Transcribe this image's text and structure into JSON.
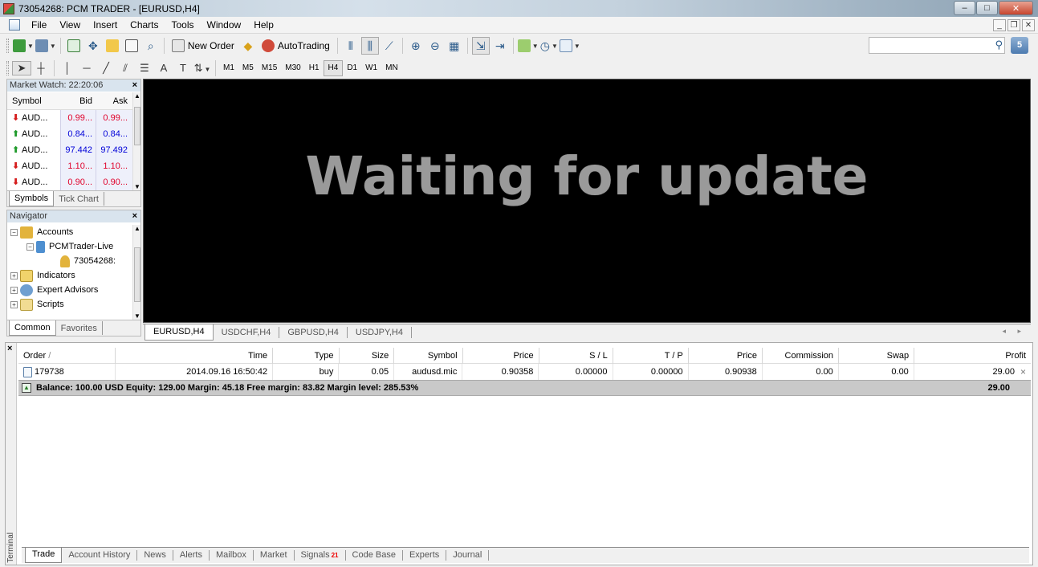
{
  "window": {
    "title": "73054268: PCM TRADER - [EURUSD,H4]",
    "controls": {
      "minimize": "–",
      "maximize": "□",
      "close": "✕"
    }
  },
  "menu": {
    "items": [
      "File",
      "View",
      "Insert",
      "Charts",
      "Tools",
      "Window",
      "Help"
    ],
    "mdi": {
      "minimize": "_",
      "restore": "❐",
      "close": "✕"
    }
  },
  "toolbar": {
    "new_order": "New Order",
    "autotrading": "AutoTrading",
    "signals_count": "5",
    "draw_text": "A",
    "draw_textlabel": "T",
    "timeframes": [
      "M1",
      "M5",
      "M15",
      "M30",
      "H1",
      "H4",
      "D1",
      "W1",
      "MN"
    ],
    "active_timeframe": "H4"
  },
  "market_watch": {
    "title": "Market Watch: 22:20:06",
    "close": "×",
    "columns": {
      "symbol": "Symbol",
      "bid": "Bid",
      "ask": "Ask"
    },
    "rows": [
      {
        "dir": "down",
        "symbol": "AUD...",
        "bid": "0.99...",
        "ask": "0.99...",
        "color": "#e0002a"
      },
      {
        "dir": "up",
        "symbol": "AUD...",
        "bid": "0.84...",
        "ask": "0.84...",
        "color": "#0000d8"
      },
      {
        "dir": "up",
        "symbol": "AUD...",
        "bid": "97.442",
        "ask": "97.492",
        "color": "#0000d8"
      },
      {
        "dir": "down",
        "symbol": "AUD...",
        "bid": "1.10...",
        "ask": "1.10...",
        "color": "#e0002a"
      },
      {
        "dir": "down",
        "symbol": "AUD...",
        "bid": "0.90...",
        "ask": "0.90...",
        "color": "#e0002a"
      }
    ],
    "tabs": [
      "Symbols",
      "Tick Chart"
    ],
    "active_tab": "Symbols"
  },
  "navigator": {
    "title": "Navigator",
    "close": "×",
    "accounts": "Accounts",
    "server": "PCMTrader-Live",
    "account": "73054268:",
    "indicators": "Indicators",
    "expert_advisors": "Expert Advisors",
    "scripts": "Scripts",
    "tabs": [
      "Common",
      "Favorites"
    ],
    "active_tab": "Common"
  },
  "chart": {
    "message": "Waiting for update",
    "tabs": [
      "EURUSD,H4",
      "USDCHF,H4",
      "GBPUSD,H4",
      "USDJPY,H4"
    ],
    "active_tab": "EURUSD,H4",
    "nav_arrows": "◂ ▸"
  },
  "terminal": {
    "label": "Terminal",
    "close": "×",
    "columns": [
      "Order",
      "Time",
      "Type",
      "Size",
      "Symbol",
      "Price",
      "S / L",
      "T / P",
      "Price",
      "Commission",
      "Swap",
      "Profit"
    ],
    "sort_mark": "/",
    "orders": [
      {
        "order": "179738",
        "time": "2014.09.16 16:50:42",
        "type": "buy",
        "size": "0.05",
        "symbol": "audusd.mic",
        "open_price": "0.90358",
        "sl": "0.00000",
        "tp": "0.00000",
        "price": "0.90938",
        "commission": "0.00",
        "swap": "0.00",
        "profit": "29.00"
      }
    ],
    "row_close": "×",
    "balance_text": "Balance: 100.00 USD  Equity: 129.00  Margin: 45.18  Free margin: 83.82  Margin level: 285.53%",
    "balance_profit": "29.00",
    "tabs": [
      "Trade",
      "Account History",
      "News",
      "Alerts",
      "Mailbox",
      "Market",
      "Signals",
      "Code Base",
      "Experts",
      "Journal"
    ],
    "signals_badge": "21",
    "active_tab": "Trade"
  }
}
